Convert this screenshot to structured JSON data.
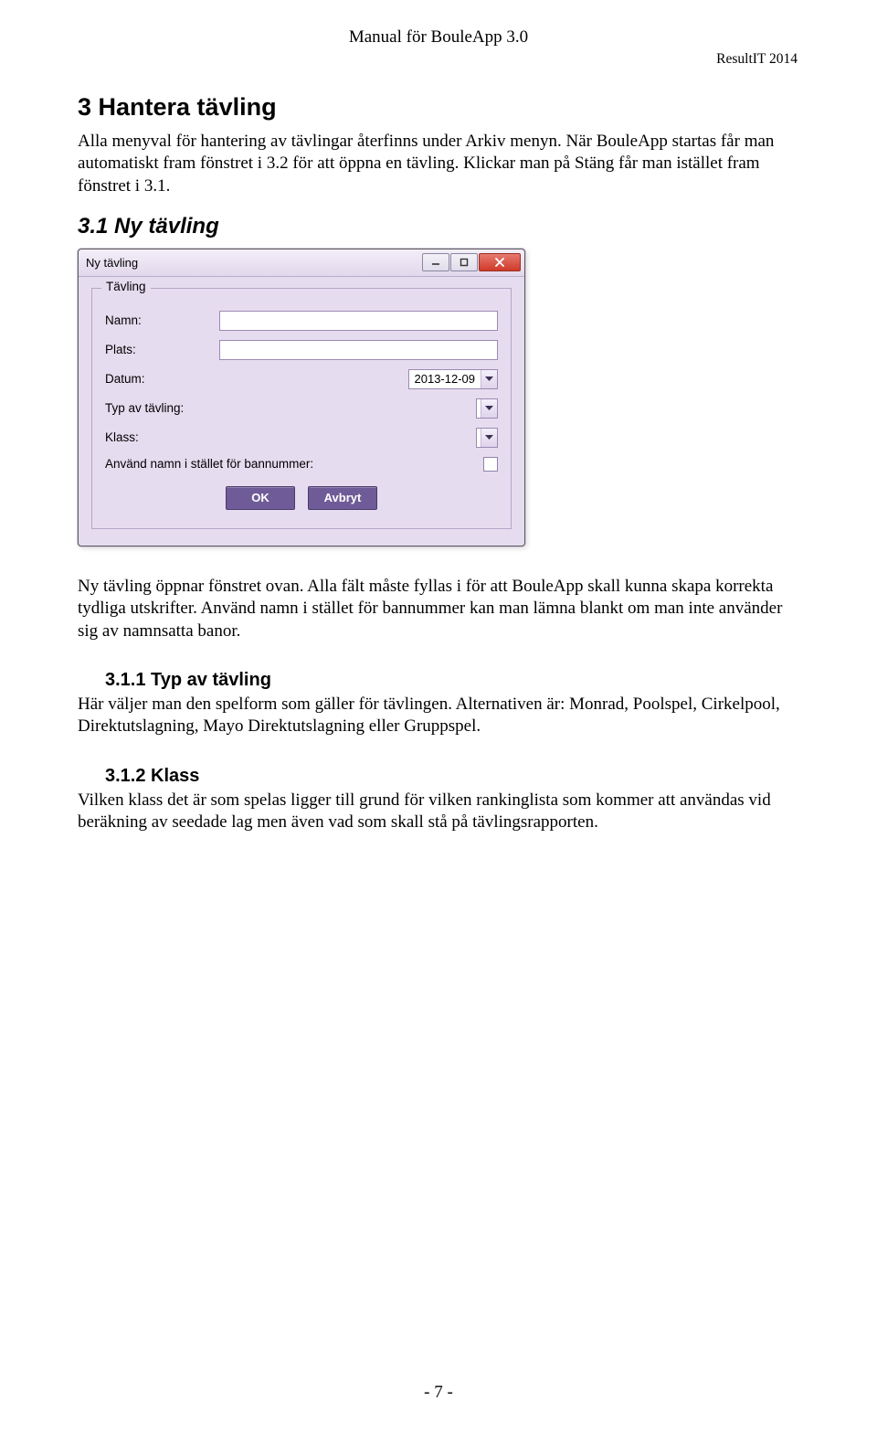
{
  "doc": {
    "header_center": "Manual för BouleApp 3.0",
    "header_right": "ResultIT 2014",
    "page_number": "- 7 -"
  },
  "sections": {
    "h1": "3  Hantera tävling",
    "p1": "Alla menyval för hantering av tävlingar återfinns under Arkiv menyn. När BouleApp startas får man automatiskt fram fönstret i 3.2 för att öppna en tävling. Klickar man på Stäng får man istället fram fönstret i 3.1.",
    "h2": "3.1  Ny tävling",
    "p2": "Ny tävling öppnar fönstret ovan. Alla fält måste fyllas i för att BouleApp skall kunna skapa korrekta tydliga utskrifter. Använd namn i stället för bannummer kan man lämna blankt om man inte använder sig av namnsatta banor.",
    "h3a": "3.1.1  Typ av tävling",
    "p3": "Här väljer man den spelform som gäller för tävlingen. Alternativen är: Monrad, Poolspel, Cirkelpool, Direktutslagning, Mayo Direktutslagning eller Gruppspel.",
    "h3b": "3.1.2  Klass",
    "p4": "Vilken klass det är som spelas ligger till grund för vilken rankinglista som kommer att användas vid beräkning av seedade lag men även vad som skall stå på tävlingsrapporten."
  },
  "dialog": {
    "title": "Ny tävling",
    "group_legend": "Tävling",
    "labels": {
      "namn": "Namn:",
      "plats": "Plats:",
      "datum": "Datum:",
      "typ": "Typ av tävling:",
      "klass": "Klass:",
      "use_name": "Använd namn i stället för bannummer:"
    },
    "date_value": "2013-12-09",
    "buttons": {
      "ok": "OK",
      "cancel": "Avbryt"
    }
  }
}
